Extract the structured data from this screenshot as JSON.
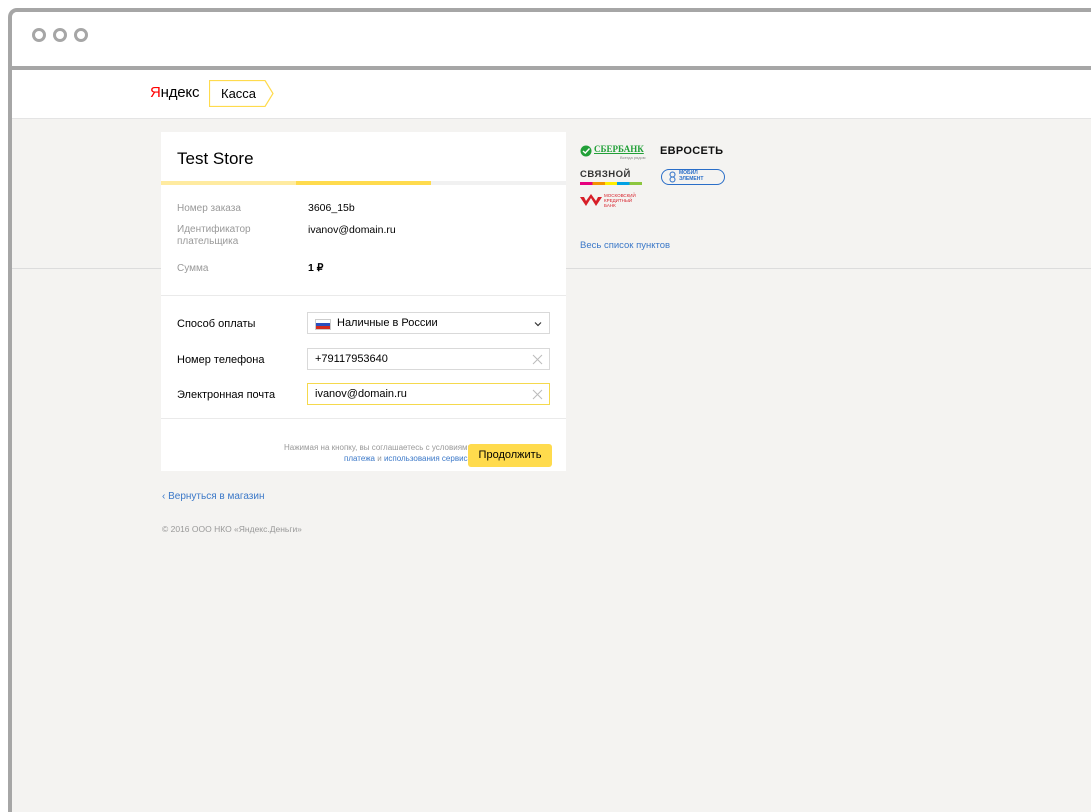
{
  "brand": {
    "logo_first": "Я",
    "logo_rest": "ндекс",
    "product": "Касса"
  },
  "store": {
    "title": "Test Store"
  },
  "order": {
    "order_label": "Номер заказа",
    "order_value": "3606_15b",
    "payer_label_1": "Идентификатор",
    "payer_label_2": "плательщика",
    "payer_value": "ivanov@domain.ru",
    "sum_label": "Сумма",
    "sum_value": "1 ₽"
  },
  "progress": {
    "steps_total": 3,
    "steps_done": 2
  },
  "form": {
    "method_label": "Способ оплаты",
    "method_value": "Наличные в России",
    "phone_label": "Номер телефона",
    "phone_value": "+79117953640",
    "email_label": "Электронная почта",
    "email_value": "ivanov@domain.ru"
  },
  "terms": {
    "line1": "Нажимая на кнопку, вы соглашаетесь с условиями",
    "link1": "платежа",
    "and": " и ",
    "link2": "использования сервиса"
  },
  "actions": {
    "continue_label": "Продолжить"
  },
  "footer": {
    "back_label": "‹ Вернуться в магазин",
    "copyright": "© 2016 ООО НКО «Яндекс.Деньги»"
  },
  "partners": {
    "sberbank": "СБЕРБАНК",
    "sberbank_tagline": "Всегда рядом",
    "euroset": "ЕВРОСЕТЬ",
    "svyaznoy": "СВЯЗНОЙ",
    "mobile_element_1": "МОБИЛ",
    "mobile_element_2": "ЭЛЕМЕНТ",
    "mkb_1": "МОСКОВСКИЙ",
    "mkb_2": "КРЕДИТНЫЙ",
    "mkb_3": "БАНК",
    "all_points": "Весь список пунктов"
  },
  "colors": {
    "accent": "#ffdb4d",
    "link": "#3b78c8",
    "page_bg": "#f4f3f1",
    "logo_red": "#ff0000"
  }
}
